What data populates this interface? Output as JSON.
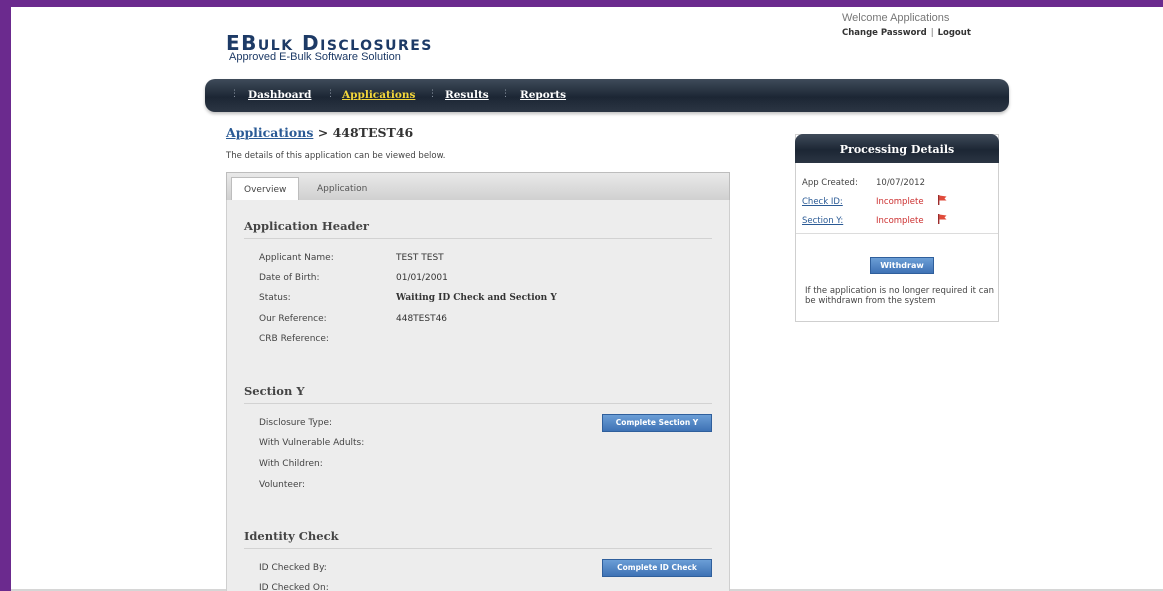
{
  "brand": {
    "title": "EBulk Disclosures",
    "subtitle": "Approved E-Bulk Software Solution"
  },
  "account": {
    "welcome": "Welcome Applications",
    "change_password": "Change Password",
    "logout": "Logout",
    "separator": "|"
  },
  "nav": {
    "items": [
      {
        "label": "Dashboard",
        "active": false
      },
      {
        "label": "Applications",
        "active": true
      },
      {
        "label": "Results",
        "active": false
      },
      {
        "label": "Reports",
        "active": false
      }
    ]
  },
  "breadcrumb": {
    "parent": "Applications",
    "separator": " > ",
    "current": "448TEST46"
  },
  "intro": "The details of this application can be viewed below.",
  "tabs": [
    {
      "label": "Overview",
      "active": true
    },
    {
      "label": "Application",
      "active": false
    }
  ],
  "application_header": {
    "title": "Application Header",
    "fields": [
      {
        "label": "Applicant Name:",
        "value": "TEST TEST"
      },
      {
        "label": "Date of Birth:",
        "value": "01/01/2001"
      },
      {
        "label": "Status:",
        "value": "Waiting ID Check and Section Y"
      },
      {
        "label": "Our Reference:",
        "value": "448TEST46"
      },
      {
        "label": "CRB Reference:",
        "value": ""
      }
    ]
  },
  "section_y": {
    "title": "Section Y",
    "button": "Complete Section Y",
    "fields": [
      {
        "label": "Disclosure Type:"
      },
      {
        "label": "With Vulnerable Adults:"
      },
      {
        "label": "With Children:"
      },
      {
        "label": "Volunteer:"
      }
    ]
  },
  "identity_check": {
    "title": "Identity Check",
    "button": "Complete ID Check",
    "fields": [
      {
        "label": "ID Checked By:"
      },
      {
        "label": "ID Checked On:"
      }
    ]
  },
  "processing": {
    "title": "Processing Details",
    "rows": [
      {
        "label": "App Created:",
        "value": "10/07/2012",
        "link": false
      },
      {
        "label": "Check ID:",
        "value": "Incomplete",
        "link": true
      },
      {
        "label": "Section Y:",
        "value": "Incomplete",
        "link": true
      }
    ],
    "withdraw_button": "Withdraw",
    "note": "If the application is no longer required it can be withdrawn from the system"
  },
  "colors": {
    "frame": "#6b2a8e",
    "brand": "#1d3a66",
    "nav_active": "#f3d63a",
    "link": "#2a5a95",
    "incomplete": "#cc2f2f",
    "button": "#3e72b5"
  }
}
